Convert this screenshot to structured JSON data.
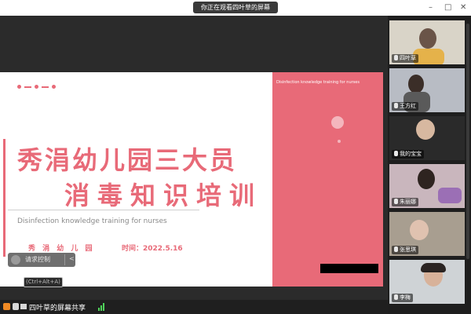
{
  "window": {
    "share_indicator": "你正在观看四叶草的屏幕",
    "controls": {
      "minimize": "–",
      "maximize": "□",
      "close": "✕"
    }
  },
  "slide": {
    "pink_subtitle": "Disinfection knowledge training for nurses",
    "title_line1": "秀涓幼儿园三大员",
    "title_line2": "消毒知识培训",
    "subtitle_en": "Disinfection knowledge training for nurses",
    "school": "秀 涓 幼 儿 园",
    "date": "时间：2022.5.16"
  },
  "annotation": {
    "label": "请求控制",
    "shortcut": "(Ctrl+Alt+A)"
  },
  "participants": [
    {
      "name": "四叶草"
    },
    {
      "name": "王方红"
    },
    {
      "name": "我的宝宝"
    },
    {
      "name": "朱丽娜"
    },
    {
      "name": "张思琪"
    },
    {
      "name": "李梅"
    }
  ],
  "bottom": {
    "sharer_label": "四叶草的屏幕共享"
  },
  "colors": {
    "accent_pink": "#e86a78",
    "share_orange": "#f08a24"
  }
}
